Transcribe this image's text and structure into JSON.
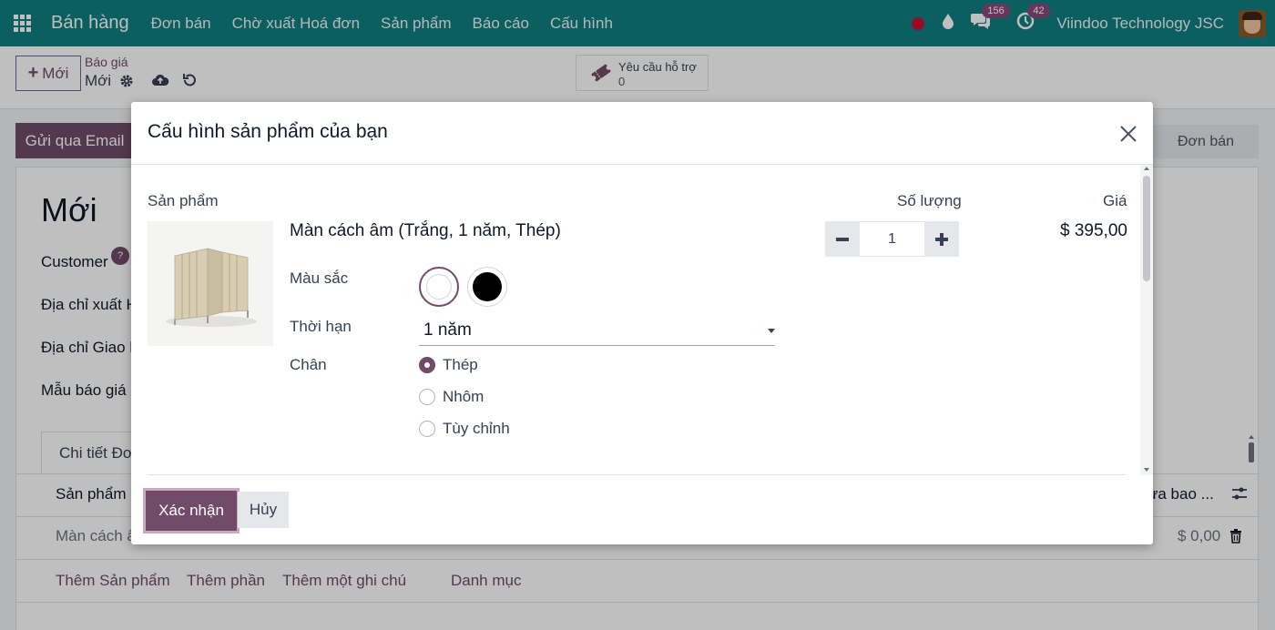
{
  "navbar": {
    "brand": "Bán hàng",
    "menu": [
      "Đơn bán",
      "Chờ xuất Hoá đơn",
      "Sản phẩm",
      "Báo cáo",
      "Cấu hình"
    ],
    "chat_count": "156",
    "activity_count": "42",
    "company": "Viindoo Technology JSC"
  },
  "control": {
    "new_label": "Mới",
    "breadcrumb_parent": "Báo giá",
    "breadcrumb_current": "Mới",
    "support_label": "Yêu cầu hỗ trợ",
    "support_count": "0"
  },
  "statusbar": {
    "email_button": "Gửi qua Email",
    "stage": "Đơn bán"
  },
  "form": {
    "title": "Mới",
    "fields": [
      "Customer",
      "Địa chỉ xuất H",
      "Địa chỉ Giao h",
      "Mẫu báo giá"
    ],
    "help_mark": "?",
    "tab": "Chi tiết Đơ",
    "col_product": "Sản phẩm",
    "col_right": "ưa bao ...",
    "row_product": "Màn cách â",
    "row_total": "$ 0,00",
    "add_product": "Thêm Sản phẩm",
    "add_section": "Thêm phần",
    "add_note": "Thêm một ghi chú",
    "catalog": "Danh mục"
  },
  "modal": {
    "title": "Cấu hình sản phẩm của bạn",
    "col_product": "Sản phẩm",
    "col_qty": "Số lượng",
    "col_price": "Giá",
    "product_name": "Màn cách âm (Trắng, 1 năm, Thép)",
    "attr_color": "Màu sắc",
    "attr_duration": "Thời hạn",
    "duration_value": "1 năm",
    "attr_leg": "Chân",
    "leg_options": [
      "Thép",
      "Nhôm",
      "Tùy chỉnh"
    ],
    "quantity": "1",
    "price": "$ 395,00",
    "confirm": "Xác nhận",
    "cancel": "Hủy"
  },
  "colors": {
    "navbar": "#0f7f80",
    "primary": "#714b67"
  }
}
